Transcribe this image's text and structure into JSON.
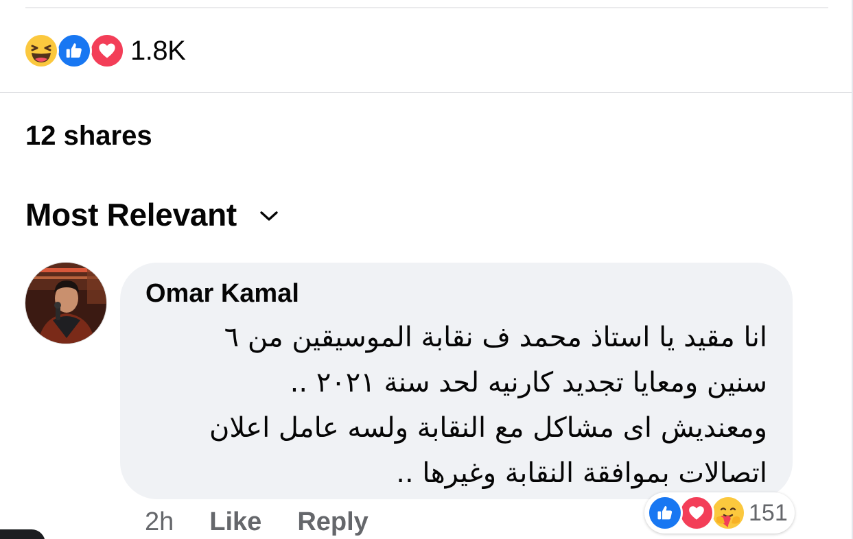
{
  "post": {
    "reactions": {
      "icons": [
        "haha-icon",
        "like-icon",
        "love-icon"
      ],
      "count": "1.8K"
    },
    "shares": "12 shares"
  },
  "comments_section": {
    "sort_label": "Most Relevant"
  },
  "comment": {
    "author": "Omar Kamal",
    "text_lines": [
      "انا مقيد يا استاذ محمد ف نقابة الموسيقين من ٦",
      "سنين ومعايا تجديد كارنيه لحد سنة ٢٠٢١ ..",
      "ومعنديش اى مشاكل مع النقابة ولسه عامل اعلان",
      "اتصالات بموافقة النقابة وغيرها .."
    ],
    "time": "2h",
    "like_label": "Like",
    "reply_label": "Reply",
    "reactions": {
      "icons": [
        "like-icon",
        "love-icon",
        "care-icon"
      ],
      "count": "151"
    }
  },
  "colors": {
    "like_blue": "#1877f2",
    "love_red": "#f33e58",
    "haha_yellow": "#fcc943",
    "bubble_bg": "#f0f2f5",
    "secondary_text": "#65676b"
  }
}
